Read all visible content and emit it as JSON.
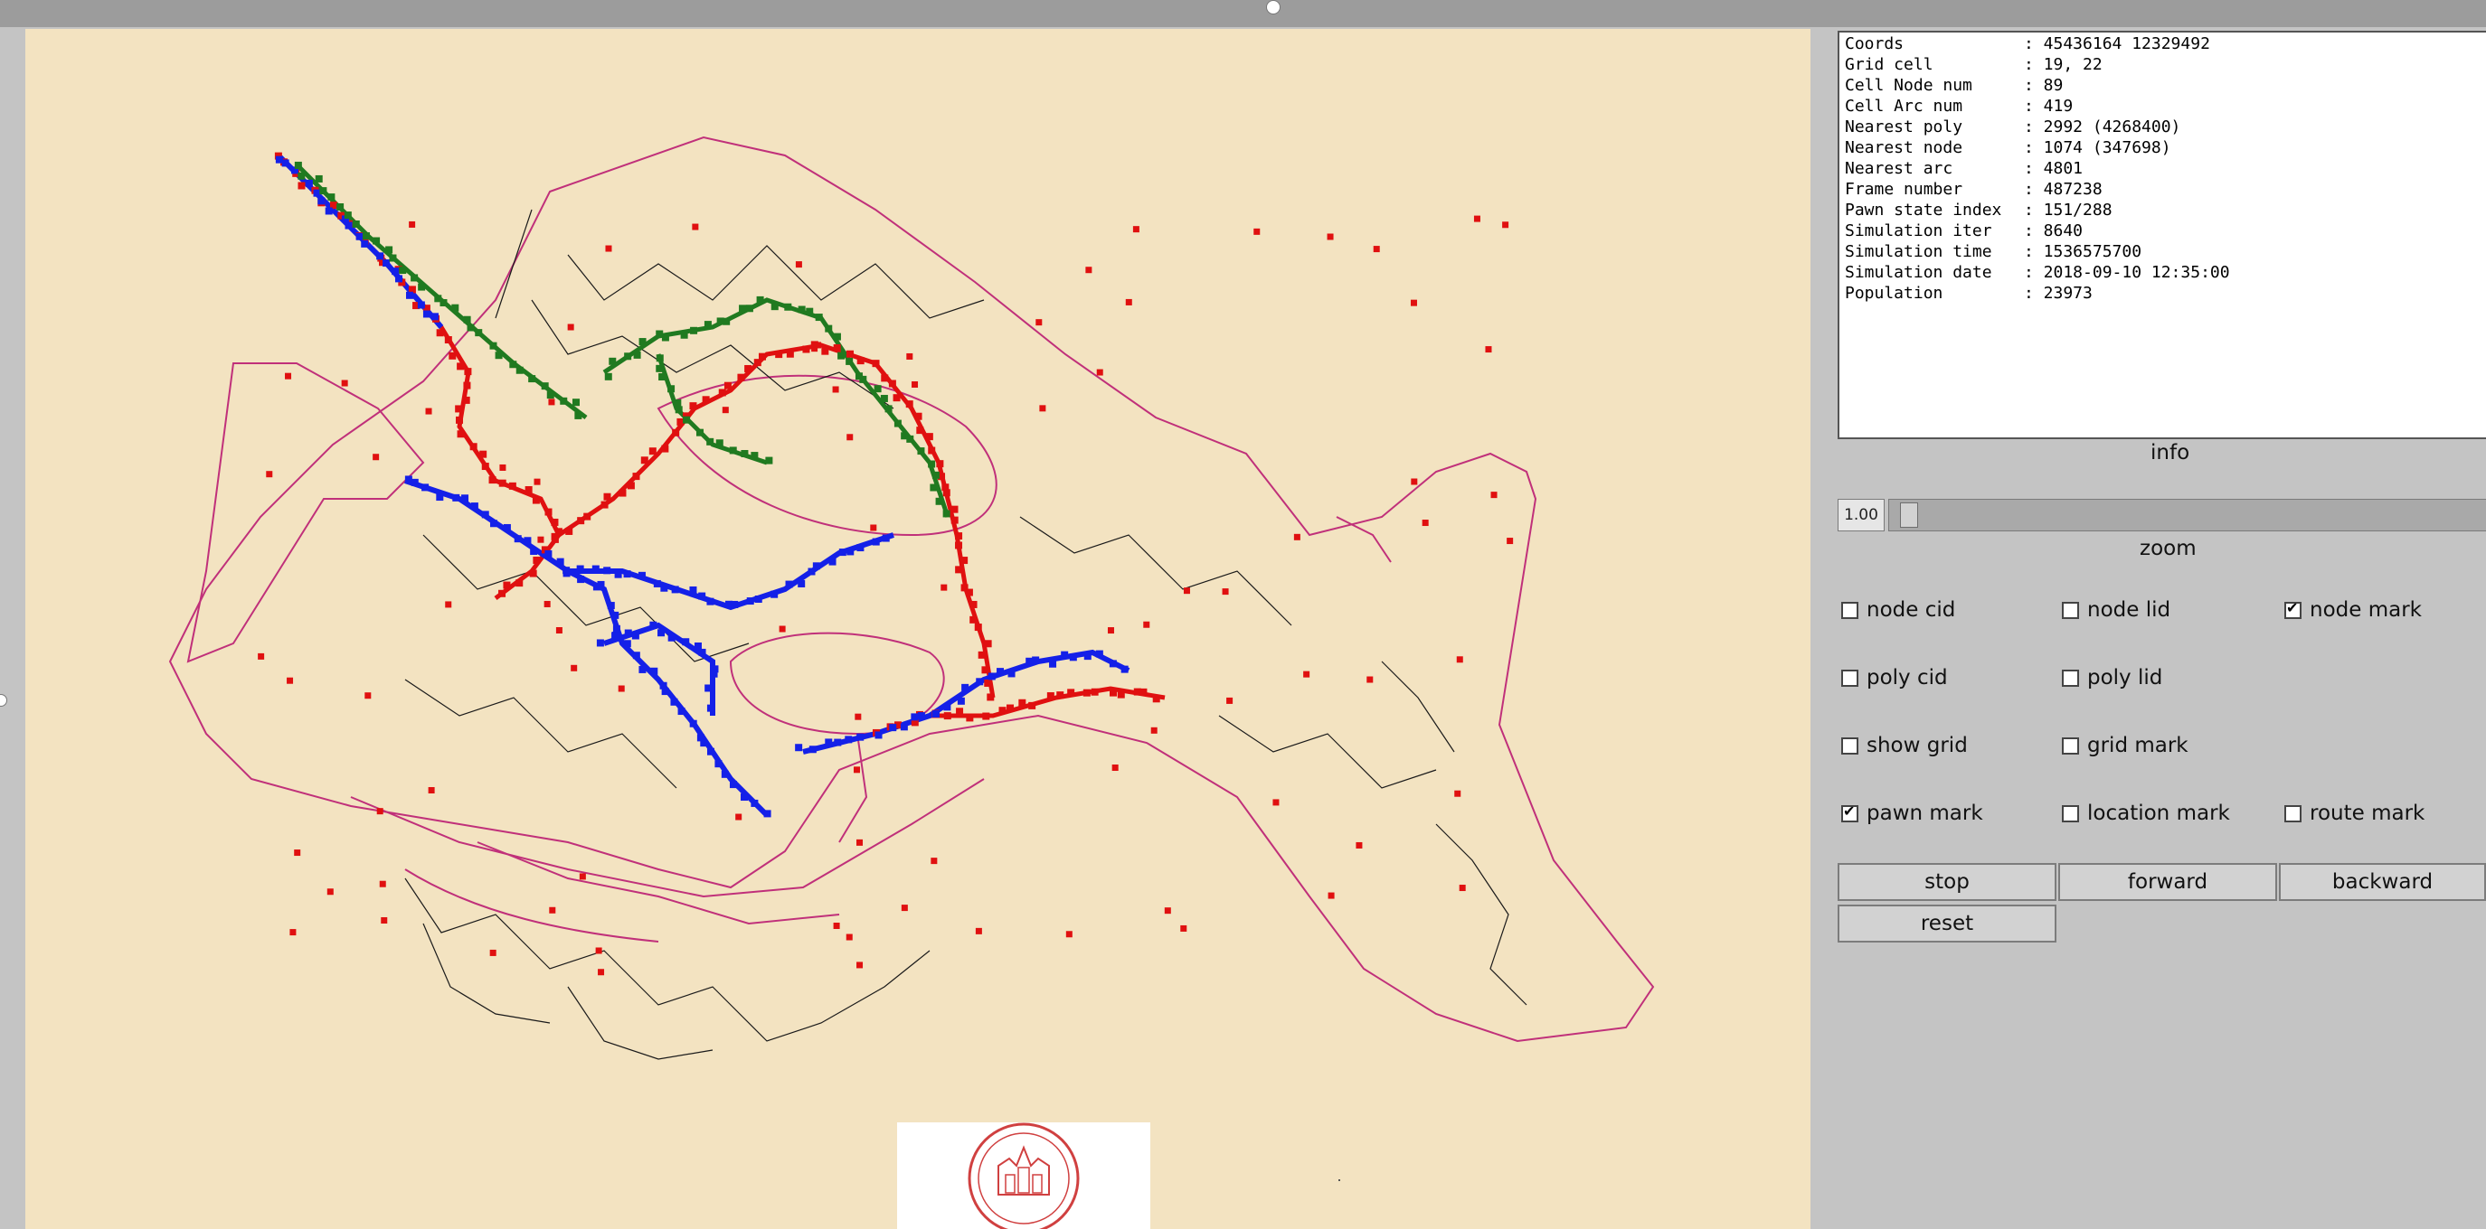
{
  "info": {
    "lines": [
      {
        "label": "Coords",
        "value": ": 45436164 12329492"
      },
      {
        "label": "Grid cell",
        "value": ": 19, 22"
      },
      {
        "label": "Cell Node num",
        "value": ": 89"
      },
      {
        "label": "Cell Arc num",
        "value": ": 419"
      },
      {
        "label": "Nearest poly",
        "value": ": 2992 (4268400)"
      },
      {
        "label": "Nearest node",
        "value": ": 1074 (347698)"
      },
      {
        "label": "Nearest arc",
        "value": ": 4801"
      },
      {
        "label": "Frame number",
        "value": ": 487238"
      },
      {
        "label": "Pawn state index",
        "value": ": 151/288"
      },
      {
        "label": "Simulation iter",
        "value": ": 8640"
      },
      {
        "label": "Simulation time",
        "value": ": 1536575700"
      },
      {
        "label": "Simulation date",
        "value": ": 2018-09-10 12:35:00"
      },
      {
        "label": "Population",
        "value": ": 23973"
      }
    ],
    "caption": "info"
  },
  "zoom": {
    "value": "1.00",
    "caption": "zoom",
    "level": 0.01
  },
  "checkboxes": {
    "node_cid": {
      "label": "node cid",
      "checked": false
    },
    "node_lid": {
      "label": "node lid",
      "checked": false
    },
    "node_mark": {
      "label": "node mark",
      "checked": true
    },
    "poly_cid": {
      "label": "poly cid",
      "checked": false
    },
    "poly_lid": {
      "label": "poly lid",
      "checked": false
    },
    "show_grid": {
      "label": "show grid",
      "checked": false
    },
    "grid_mark": {
      "label": "grid mark",
      "checked": false
    },
    "pawn_mark": {
      "label": "pawn mark",
      "checked": true
    },
    "location_mark": {
      "label": "location mark",
      "checked": false
    },
    "route_mark": {
      "label": "route mark",
      "checked": false
    }
  },
  "buttons": {
    "stop": "stop",
    "forward": "forward",
    "backward": "backward",
    "reset": "reset"
  },
  "colors": {
    "map_bg": "#f3e3c1",
    "poly_outline": "#c0307a",
    "street": "#1a1a1a",
    "pawn_red": "#e01010",
    "pawn_blue": "#1420e8",
    "pawn_green": "#207a20",
    "logo_red": "#d04040"
  },
  "map": {
    "logo_icon": "university-seal-icon"
  }
}
